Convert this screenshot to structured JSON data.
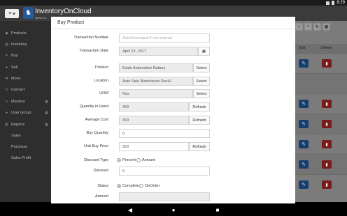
{
  "status_bar": {
    "time": "8:29"
  },
  "app": {
    "title": "InventoryOnCloud",
    "subtitle": "Serve Cl..."
  },
  "sidebar": {
    "items": [
      {
        "label": "Products",
        "icon": "tag-icon"
      },
      {
        "label": "Inventory",
        "icon": "box-icon"
      },
      {
        "label": "Buy",
        "icon": "cart-icon"
      },
      {
        "label": "Sell",
        "icon": "dollar-icon"
      },
      {
        "label": "Move",
        "icon": "move-icon"
      },
      {
        "label": "Convert",
        "icon": "convert-icon"
      },
      {
        "label": "Masters",
        "icon": "list-icon"
      },
      {
        "label": "User Group",
        "icon": "users-icon"
      },
      {
        "label": "Reports",
        "icon": "chart-icon"
      }
    ],
    "sub_items": [
      "Sales",
      "Purchase",
      "Sales Profit"
    ]
  },
  "table": {
    "columns": [
      "Edit",
      "Delete"
    ]
  },
  "modal": {
    "title": "Buy Product",
    "fields": {
      "transaction_number": {
        "label": "Transaction Number",
        "placeholder": "AutoGenerated if not entered"
      },
      "transaction_date": {
        "label": "Transaction Date",
        "value": "April 22, 2017"
      },
      "product": {
        "label": "Product",
        "value": "Exide Automotive Battery",
        "button": "Select"
      },
      "location": {
        "label": "Location",
        "value": "Auto Sale Warehouse Rack1",
        "button": "Select"
      },
      "uom": {
        "label": "UOM",
        "value": "Nos",
        "button": "Select"
      },
      "quantity_in_hand": {
        "label": "Quantity in Hand",
        "value": "400",
        "button": "Refresh"
      },
      "average_cost": {
        "label": "Average Cost",
        "value": "300",
        "button": "Refresh"
      },
      "buy_quantity": {
        "label": "Buy Quantity",
        "value": "0"
      },
      "unit_buy_price": {
        "label": "Unit Buy Price",
        "value": "300",
        "button": "Refresh"
      },
      "discount_type": {
        "label": "Discount Type",
        "options": [
          "Percent",
          "Amount"
        ],
        "selected": "Percent"
      },
      "discount": {
        "label": "Discount",
        "value": "0"
      },
      "status": {
        "label": "Status",
        "options": [
          "Complete",
          "OnOrder"
        ],
        "selected": "Complete"
      },
      "amount": {
        "label": "Amount",
        "value": ""
      }
    }
  },
  "colors": {
    "primary": "#24599a",
    "edit": "#163e6e",
    "delete": "#7a1b1b",
    "sidebar": "#2e2e2e",
    "header": "#3b3b3b"
  }
}
